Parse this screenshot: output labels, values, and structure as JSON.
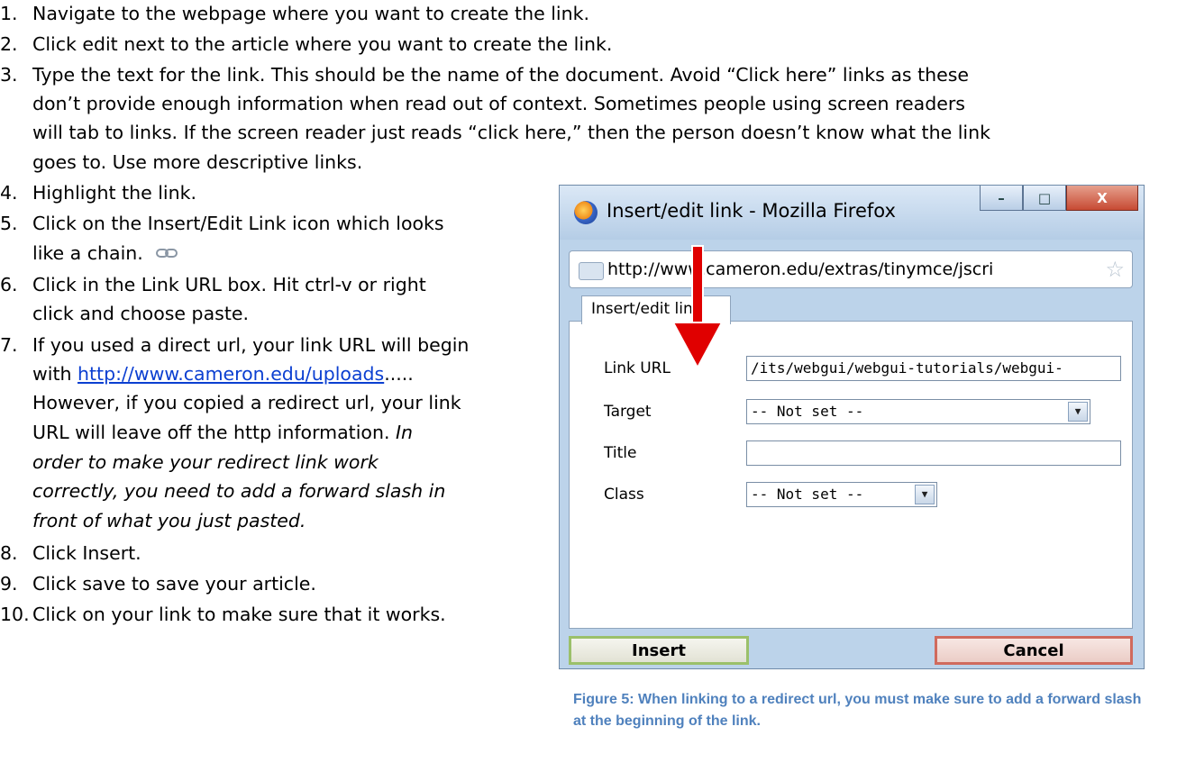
{
  "steps": [
    {
      "num": "1.",
      "lines": [
        "Navigate to the webpage where you want to create the link."
      ]
    },
    {
      "num": "2.",
      "lines": [
        "Click edit next to the article where you want to create the link."
      ]
    },
    {
      "num": "3.",
      "lines": [
        "Type the text for the link. This should be the name of the document. Avoid “Click here” links as these",
        "don’t provide enough information when read out of context. Sometimes people using screen readers",
        "will tab to links. If the screen reader just reads “click here,” then the person doesn’t know what the link",
        "goes to. Use more descriptive links."
      ]
    },
    {
      "num": "4.",
      "lines": [
        "Highlight the link."
      ]
    },
    {
      "num": "5.",
      "lines": [
        "Click on the Insert/Edit Link icon which looks",
        "like a chain."
      ]
    },
    {
      "num": "6.",
      "lines": [
        "Click in the Link URL box. Hit ctrl-v or right",
        "click and choose paste."
      ]
    },
    {
      "num": "7.",
      "line1": "If you used a direct url, your link URL will begin",
      "line2_prefix": "with ",
      "line2_link": "http://www.cameron.edu/uploads",
      "line2_suffix": ".....",
      "line3": "However, if you copied a redirect url, your link",
      "line4": "URL will leave off the http information. ",
      "line4_italic": "In",
      "italic_lines": [
        "order to make your redirect link work",
        "correctly, you need to add a forward slash in",
        "front of what you just pasted."
      ]
    },
    {
      "num": "8.",
      "lines": [
        "Click Insert."
      ]
    },
    {
      "num": "9.",
      "lines": [
        "Click save to save your article."
      ]
    },
    {
      "num": "10.",
      "lines": [
        "Click on your link to make sure that it works."
      ]
    }
  ],
  "dialog": {
    "window_title": "Insert/edit link - Mozilla Firefox",
    "minimize": "–",
    "maximize": "□",
    "close": "X",
    "address": "http://www.cameron.edu/extras/tinymce/jscri",
    "tab": "Insert/edit link",
    "link_url_label": "Link URL",
    "link_url_value": "/its/webgui/webgui-tutorials/webgui-",
    "target_label": "Target",
    "target_value": "-- Not set --",
    "title_label": "Title",
    "title_value": "",
    "class_label": "Class",
    "class_value": "-- Not set --",
    "insert_label": "Insert",
    "cancel_label": "Cancel"
  },
  "caption": "Figure 5: When linking to a redirect url, you must make sure to add a forward slash at the beginning of the link.",
  "colors": {
    "caption": "#4f81bd",
    "link": "#0b3fd1",
    "arrow": "#e00000"
  }
}
